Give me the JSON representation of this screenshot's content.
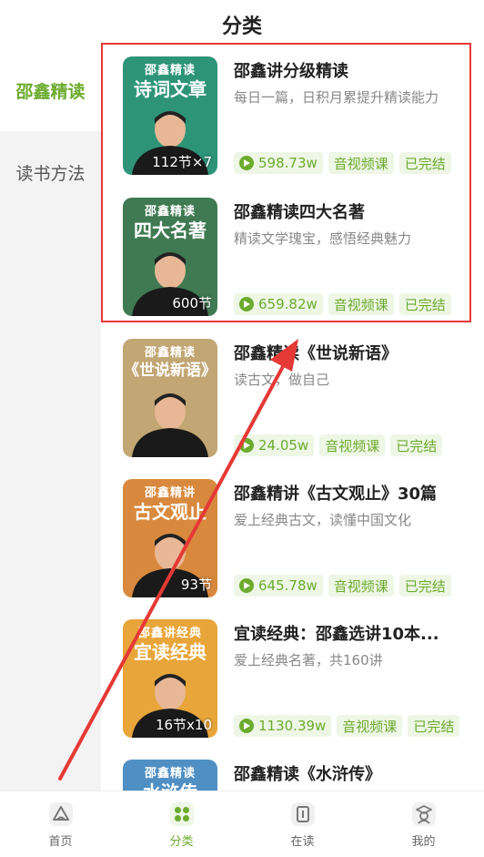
{
  "header": {
    "title": "分类"
  },
  "sidebar": {
    "items": [
      {
        "label": "邵鑫精读",
        "active": true
      },
      {
        "label": "读书方法",
        "active": false
      }
    ]
  },
  "courses": [
    {
      "cover_brand": "邵鑫精读",
      "cover_title": "诗词文章",
      "cover_count": "112节×7",
      "cover_color": "#2e9478",
      "title": "邵鑫讲分级精读",
      "desc": "每日一篇，日积月累提升精读能力",
      "plays": "598.73w",
      "type": "音视频课",
      "status": "已完结"
    },
    {
      "cover_brand": "邵鑫精读",
      "cover_title": "四大名著",
      "cover_count": "600节",
      "cover_color": "#3f7a52",
      "title": "邵鑫精读四大名著",
      "desc": "精读文学瑰宝，感悟经典魅力",
      "plays": "659.82w",
      "type": "音视频课",
      "status": "已完结"
    },
    {
      "cover_brand": "邵鑫精读",
      "cover_title": "《世说新语》",
      "cover_count": "",
      "cover_color": "#c2a673",
      "title": "邵鑫精读《世说新语》",
      "desc": "读古文，做自己",
      "plays": "24.05w",
      "type": "音视频课",
      "status": "已完结"
    },
    {
      "cover_brand": "邵鑫精讲",
      "cover_title": "古文观止",
      "cover_count": "93节",
      "cover_color": "#d9893e",
      "title": "邵鑫精讲《古文观止》30篇",
      "desc": "爱上经典古文，读懂中国文化",
      "plays": "645.78w",
      "type": "音视频课",
      "status": "已完结"
    },
    {
      "cover_brand": "邵鑫讲经典",
      "cover_title": "宜读经典",
      "cover_count": "16节x10",
      "cover_color": "#e8a53a",
      "title": "宜读经典：邵鑫选讲10本...",
      "desc": "爱上经典名著，共160讲",
      "plays": "1130.39w",
      "type": "音视频课",
      "status": "已完结"
    },
    {
      "cover_brand": "邵鑫精读",
      "cover_title": "水浒传",
      "cover_count": "",
      "cover_color": "#4f8fc4",
      "title": "邵鑫精读《水浒传》",
      "desc": "",
      "plays": "",
      "type": "",
      "status": ""
    }
  ],
  "tabbar": {
    "items": [
      {
        "label": "首页",
        "icon": "home-icon",
        "active": false
      },
      {
        "label": "分类",
        "icon": "category-icon",
        "active": true
      },
      {
        "label": "在读",
        "icon": "reading-icon",
        "active": false
      },
      {
        "label": "我的",
        "icon": "profile-icon",
        "active": false
      }
    ]
  },
  "colors": {
    "accent": "#6cab2e",
    "highlight": "#e53935"
  }
}
